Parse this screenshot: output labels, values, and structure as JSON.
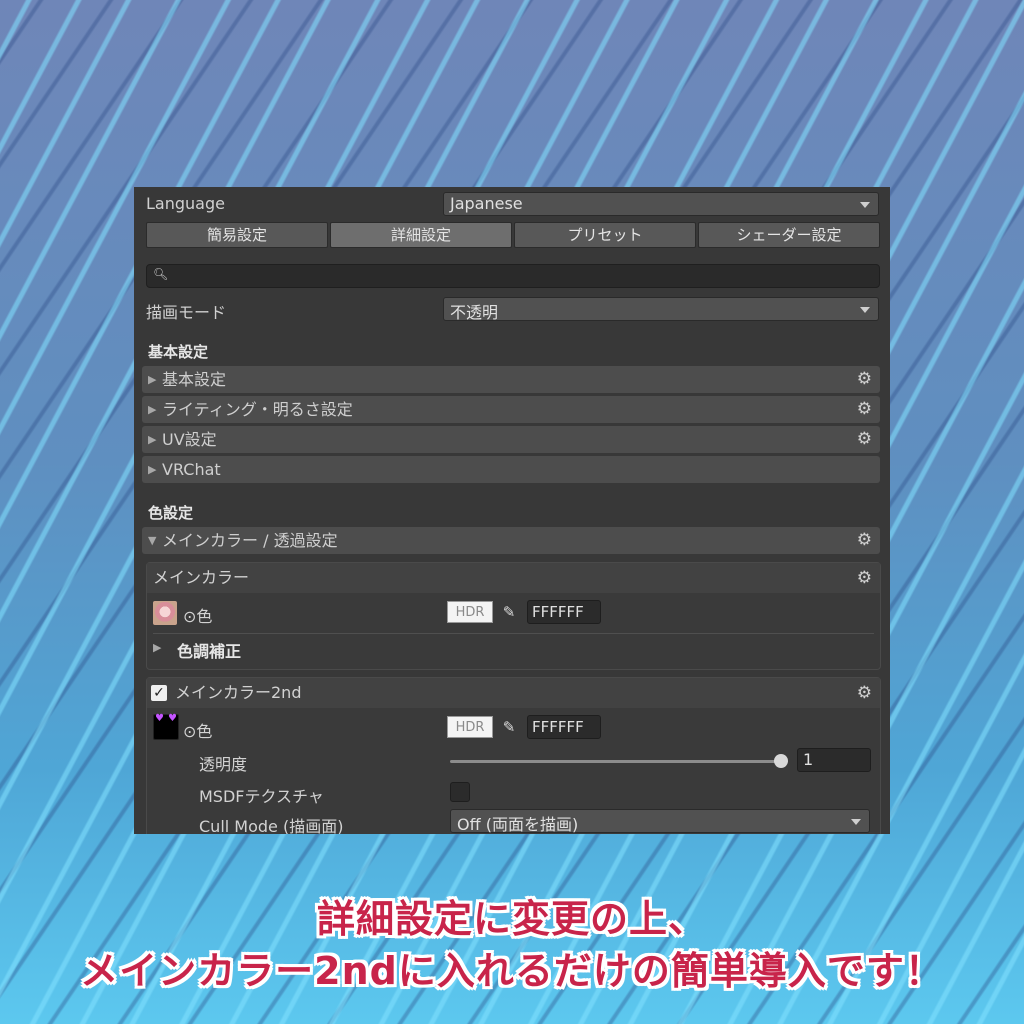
{
  "language": {
    "label": "Language",
    "value": "Japanese"
  },
  "tabs": [
    {
      "label": "簡易設定",
      "active": false
    },
    {
      "label": "詳細設定",
      "active": true
    },
    {
      "label": "プリセット",
      "active": false
    },
    {
      "label": "シェーダー設定",
      "active": false
    }
  ],
  "search": {
    "placeholder": ""
  },
  "render_mode": {
    "label": "描画モード",
    "value": "不透明"
  },
  "basic": {
    "title": "基本設定",
    "items": [
      {
        "label": "基本設定"
      },
      {
        "label": "ライティング・明るさ設定"
      },
      {
        "label": "UV設定"
      },
      {
        "label": "VRChat"
      }
    ]
  },
  "color": {
    "title": "色設定",
    "fold_label": "メインカラー / 透過設定",
    "main": {
      "header": "メインカラー",
      "color_label": "⊙色",
      "hdr": "HDR",
      "hex": "FFFFFF",
      "tone": "色調補正"
    },
    "main2": {
      "header": "メインカラー2nd",
      "enabled": true,
      "color_label": "⊙色",
      "hdr": "HDR",
      "hex": "FFFFFF",
      "alpha_label": "透明度",
      "alpha_value": "1",
      "alpha_fraction": 1,
      "msdf_label": "MSDFテクスチャ",
      "cull_label": "Cull Mode (描画面)",
      "cull_value": "Off (両面を描画)"
    }
  },
  "caption": {
    "line1": "詳細設定に変更の上、",
    "line2": "メインカラー2ndに入れるだけの簡単導入です！"
  }
}
